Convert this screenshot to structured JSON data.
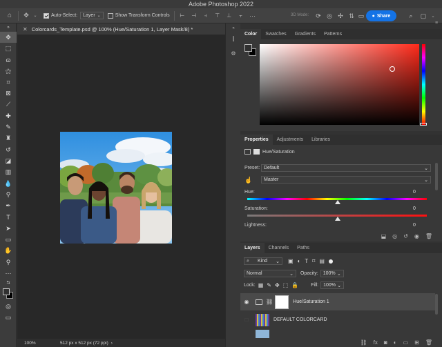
{
  "app": {
    "title": "Adobe Photoshop 2022"
  },
  "options_bar": {
    "auto_select_label": "Auto-Select:",
    "auto_select_target": "Layer",
    "show_transform_label": "Show Transform Controls",
    "mode_3d_label": "3D Mode:",
    "share_label": "Share"
  },
  "document": {
    "tab_title": "Colorcards_Template.psd @ 100% (Hue/Saturation 1, Layer Mask/8) *",
    "zoom": "100%",
    "dimensions": "512 px x 512 px (72 ppi)"
  },
  "color_panel": {
    "tabs": [
      "Color",
      "Swatches",
      "Gradients",
      "Patterns"
    ],
    "active_tab": "Color",
    "hue_color": "#ff2a1a"
  },
  "properties_panel": {
    "tabs": [
      "Properties",
      "Adjustments",
      "Libraries"
    ],
    "adjustment_title": "Hue/Saturation",
    "preset_label": "Preset:",
    "preset_value": "Default",
    "channel_value": "Master",
    "hue_label": "Hue:",
    "hue_value": "0",
    "saturation_label": "Saturation:",
    "saturation_value": "0",
    "lightness_label": "Lightness:",
    "lightness_value": "0"
  },
  "layers_panel": {
    "tabs": [
      "Layers",
      "Channels",
      "Paths"
    ],
    "filter_kind": "Kind",
    "blend_mode": "Normal",
    "opacity_label": "Opacity:",
    "opacity_value": "100%",
    "lock_label": "Lock:",
    "fill_label": "Fill:",
    "fill_value": "100%",
    "layers": [
      {
        "name": "Hue/Saturation 1",
        "selected": true,
        "visible": true
      },
      {
        "name": "DEFAULT COLORCARD",
        "selected": false,
        "visible": false
      },
      {
        "name": "",
        "selected": false,
        "visible": false
      }
    ]
  },
  "icons": {
    "home": "home-icon",
    "move": "move-icon",
    "more": "more-icon",
    "search": "search-icon",
    "workspace": "workspace-icon"
  }
}
